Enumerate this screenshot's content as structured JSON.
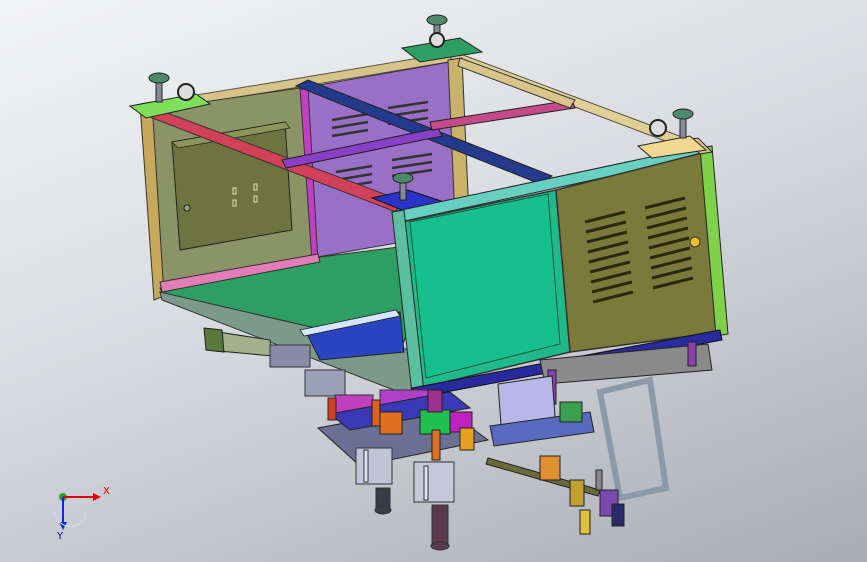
{
  "viewport": {
    "title": "",
    "background_top": "#f3f4f6",
    "background_bottom": "#a9acb3"
  },
  "triad": {
    "x_label": "X",
    "y_label": "Y",
    "x_color": "#e00000",
    "y_color": "#0030d0",
    "z_color": "#00b000"
  },
  "model": {
    "description_icon": "cad-assembly-frame-icon",
    "colors": {
      "left_panel": "#8a9466",
      "rear_panel": "#9a6fc8",
      "front_green_panel": "#1fba8a",
      "right_vented_panel": "#7c7a3a",
      "top_beam_red": "#d2405a",
      "top_beam_blue": "#243a8c",
      "frame_tan": "#d8c48a",
      "frame_lime": "#7fd14a",
      "floor_green": "#2e9f62",
      "caster_green": "#3a8a5a"
    }
  }
}
